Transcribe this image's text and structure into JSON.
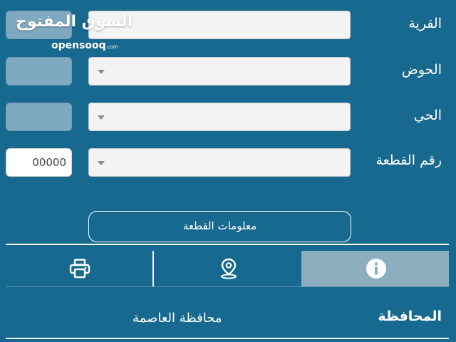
{
  "watermark": {
    "arabic": "السوق المفتوح",
    "latin": "opensooq",
    "latin_suffix": ".com"
  },
  "form": {
    "village_label": "القرية",
    "basin_label": "الحوض",
    "neighborhood_label": "الحي",
    "plot_number_label": "رقم القطعة",
    "plot_number_value": "00000"
  },
  "plot_info_button": "معلومات القطعة",
  "tabs": [
    {
      "name": "info",
      "icon": "info-icon",
      "selected": true
    },
    {
      "name": "location",
      "icon": "map-pin-icon",
      "selected": false
    },
    {
      "name": "print",
      "icon": "printer-icon",
      "selected": false
    }
  ],
  "details": {
    "governorate_label": "المحافظة",
    "governorate_value": "محافظة العاصمة"
  },
  "colors": {
    "background": "#17698f",
    "selected_tab": "#8daebf",
    "disabled_box": "#7fa9c0",
    "field_bg": "#f3f3f3"
  }
}
